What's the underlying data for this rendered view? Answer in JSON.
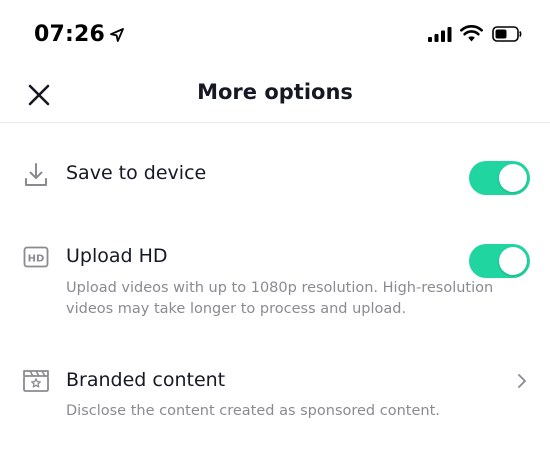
{
  "status_bar": {
    "time": "07:26",
    "icons": [
      "location-arrow-icon",
      "cellular-signal-icon",
      "wifi-icon",
      "battery-icon"
    ]
  },
  "header": {
    "title": "More options",
    "close_icon": "close-icon"
  },
  "options": [
    {
      "label": "Save to device",
      "icon": "download-icon",
      "control": "toggle",
      "enabled": true
    },
    {
      "label": "Upload HD",
      "icon": "hd-icon",
      "icon_text": "HD",
      "control": "toggle",
      "enabled": true,
      "description": "Upload videos with up to 1080p resolution. High-resolution videos may take longer to process and upload."
    },
    {
      "label": "Branded content",
      "icon": "branded-content-icon",
      "control": "chevron",
      "description": "Disclose the content created as sponsored content."
    }
  ],
  "colors": {
    "toggle_on": "#20d5a0",
    "text_primary": "#161823",
    "text_secondary": "#8a8b91",
    "icon_gray": "#8a8b91",
    "divider": "#eaeaeb"
  }
}
